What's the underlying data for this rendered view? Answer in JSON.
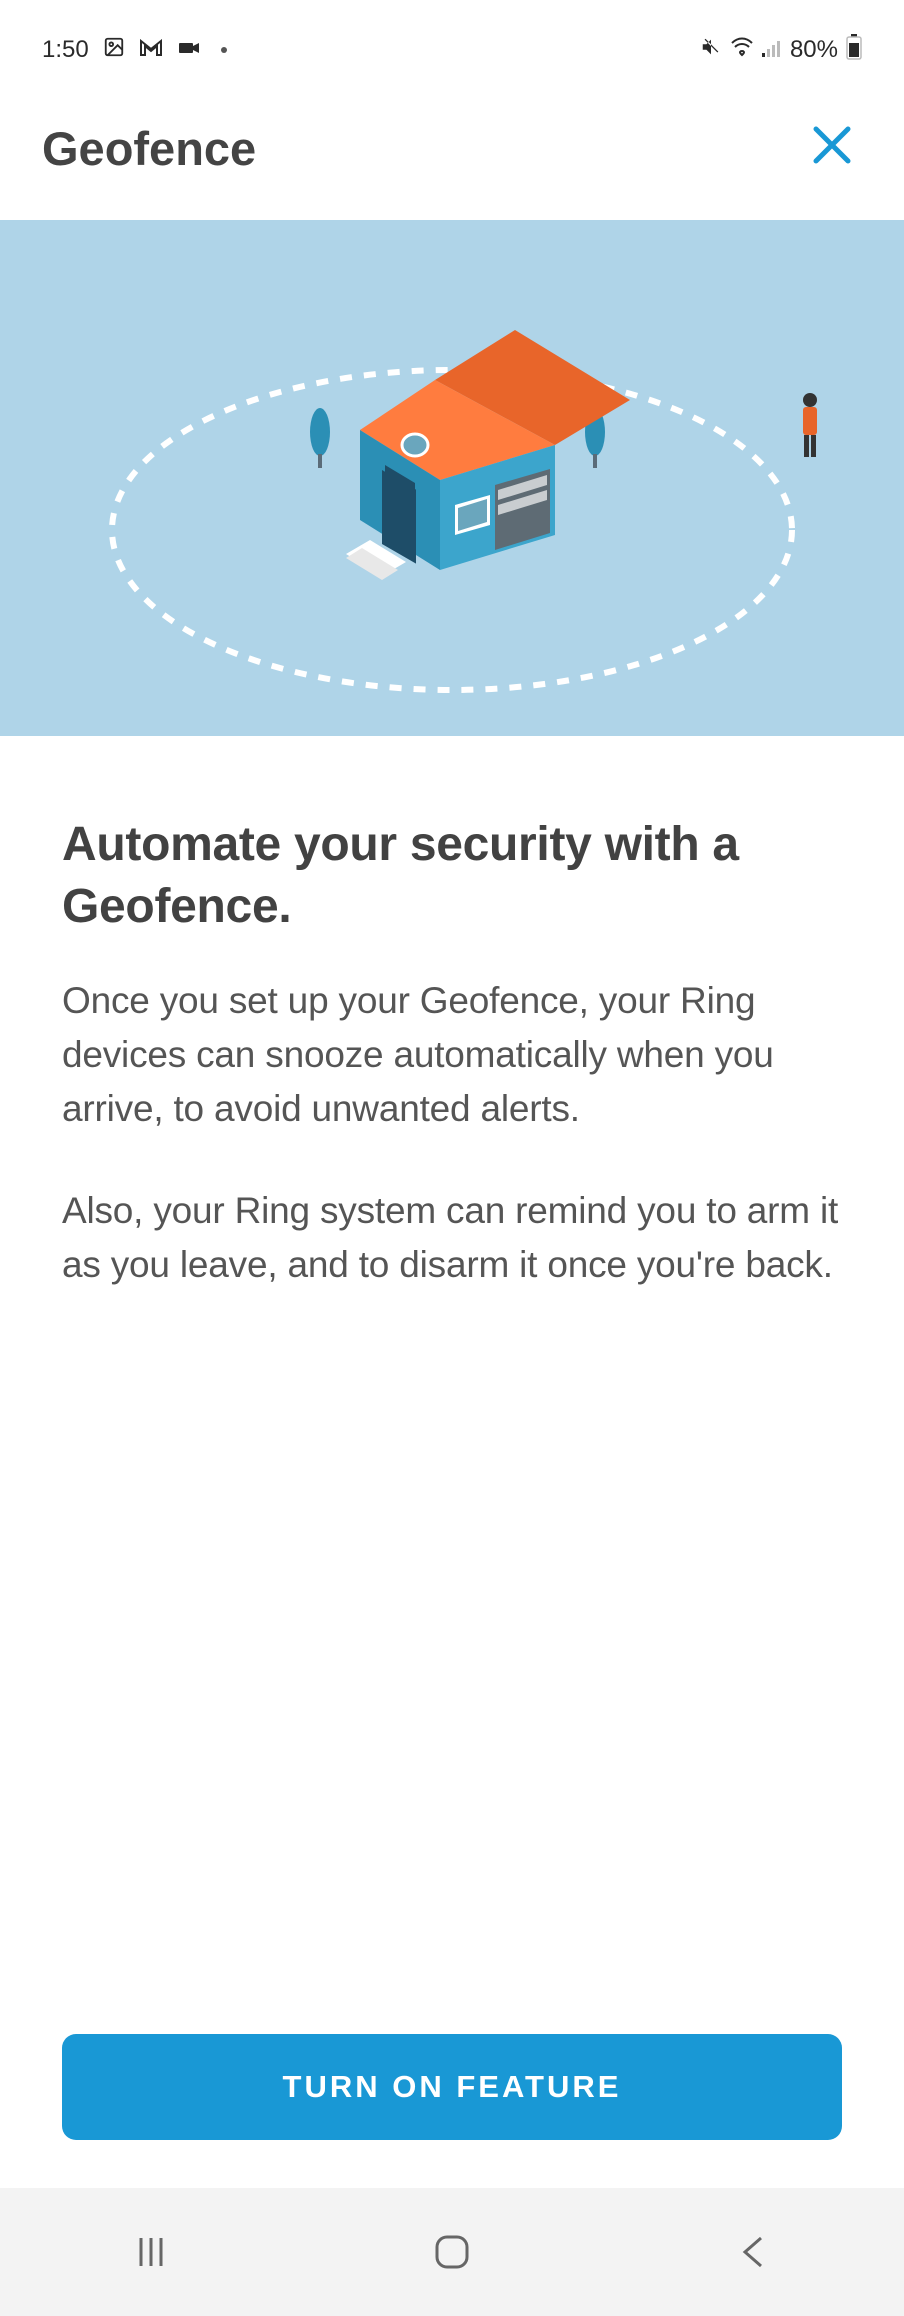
{
  "status": {
    "time": "1:50",
    "battery": "80%"
  },
  "header": {
    "title": "Geofence"
  },
  "content": {
    "heading": "Automate your security with a Geofence.",
    "p1": "Once you set up your Geofence, your Ring devices can snooze automatically when you arrive, to avoid unwanted alerts.",
    "p2": "Also, your Ring system can remind you to arm it as you leave, and to disarm it once you're back."
  },
  "cta": {
    "label": "TURN ON FEATURE"
  }
}
